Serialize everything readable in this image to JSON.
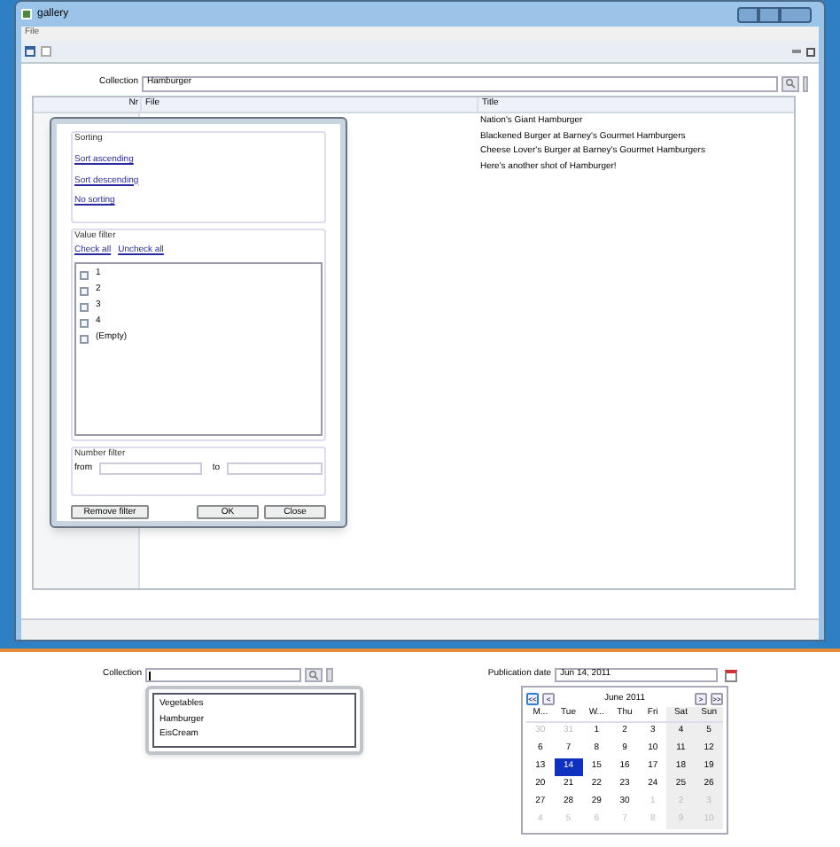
{
  "window": {
    "title": "gallery"
  },
  "menu": [
    "File"
  ],
  "collection": {
    "label": "Collection",
    "value": "Hamburger"
  },
  "table": {
    "columns": [
      "Nr",
      "File",
      "Title"
    ],
    "rows": [
      {
        "title": "Nation's Giant Hamburger"
      },
      {
        "title": "Blackened Burger at Barney's Gourmet Hamburgers"
      },
      {
        "title": "Cheese Lover's Burger at Barney's Gourmet Hamburgers"
      },
      {
        "title": "Here's another shot of Hamburger!"
      }
    ]
  },
  "filter_popup": {
    "sorting": {
      "legend": "Sorting",
      "links": [
        "Sort ascending",
        "Sort descending",
        "No sorting"
      ]
    },
    "value_filter": {
      "legend": "Value filter",
      "check_all": "Check all",
      "uncheck_all": "Uncheck all",
      "items": [
        {
          "label": "1",
          "checked": false
        },
        {
          "label": "2",
          "checked": false
        },
        {
          "label": "3",
          "checked": false
        },
        {
          "label": "4",
          "checked": false
        },
        {
          "label": "(Empty)",
          "checked": false
        }
      ]
    },
    "number_filter": {
      "legend": "Number filter",
      "from": "from",
      "to": "to"
    },
    "buttons": {
      "remove": "Remove filter",
      "ok": "OK",
      "close": "Close"
    }
  },
  "bottom_collection": {
    "label": "Collection",
    "options": [
      "Vegetables",
      "Hamburger",
      "EisCream"
    ]
  },
  "publication_date": {
    "label": "Publication date",
    "value": "Jun 14, 2011",
    "calendar": {
      "month": "June 2011",
      "nav": [
        "<<",
        "<",
        ">",
        ">>"
      ],
      "weekdays": [
        "M...",
        "Tue",
        "W...",
        "Thu",
        "Fri",
        "Sat",
        "Sun"
      ],
      "days": [
        {
          "text": "30",
          "other_month": true,
          "selected": false
        },
        {
          "text": "31",
          "other_month": true,
          "selected": false
        },
        {
          "text": "1",
          "other_month": false,
          "selected": false
        },
        {
          "text": "2",
          "other_month": false,
          "selected": false
        },
        {
          "text": "3",
          "other_month": false,
          "selected": false
        },
        {
          "text": "4",
          "other_month": false,
          "selected": false
        },
        {
          "text": "5",
          "other_month": false,
          "selected": false
        },
        {
          "text": "6",
          "other_month": false,
          "selected": false
        },
        {
          "text": "7",
          "other_month": false,
          "selected": false
        },
        {
          "text": "8",
          "other_month": false,
          "selected": false
        },
        {
          "text": "9",
          "other_month": false,
          "selected": false
        },
        {
          "text": "10",
          "other_month": false,
          "selected": false
        },
        {
          "text": "11",
          "other_month": false,
          "selected": false
        },
        {
          "text": "12",
          "other_month": false,
          "selected": false
        },
        {
          "text": "13",
          "other_month": false,
          "selected": false
        },
        {
          "text": "14",
          "other_month": false,
          "selected": true
        },
        {
          "text": "15",
          "other_month": false,
          "selected": false
        },
        {
          "text": "16",
          "other_month": false,
          "selected": false
        },
        {
          "text": "17",
          "other_month": false,
          "selected": false
        },
        {
          "text": "18",
          "other_month": false,
          "selected": false
        },
        {
          "text": "19",
          "other_month": false,
          "selected": false
        },
        {
          "text": "20",
          "other_month": false,
          "selected": false
        },
        {
          "text": "21",
          "other_month": false,
          "selected": false
        },
        {
          "text": "22",
          "other_month": false,
          "selected": false
        },
        {
          "text": "23",
          "other_month": false,
          "selected": false
        },
        {
          "text": "24",
          "other_month": false,
          "selected": false
        },
        {
          "text": "25",
          "other_month": false,
          "selected": false
        },
        {
          "text": "26",
          "other_month": false,
          "selected": false
        },
        {
          "text": "27",
          "other_month": false,
          "selected": false
        },
        {
          "text": "28",
          "other_month": false,
          "selected": false
        },
        {
          "text": "29",
          "other_month": false,
          "selected": false
        },
        {
          "text": "30",
          "other_month": false,
          "selected": false
        },
        {
          "text": "1",
          "other_month": true,
          "selected": false
        },
        {
          "text": "2",
          "other_month": true,
          "selected": false
        },
        {
          "text": "3",
          "other_month": true,
          "selected": false
        },
        {
          "text": "4",
          "other_month": true,
          "selected": false
        },
        {
          "text": "5",
          "other_month": true,
          "selected": false
        },
        {
          "text": "6",
          "other_month": true,
          "selected": false
        },
        {
          "text": "7",
          "other_month": true,
          "selected": false
        },
        {
          "text": "8",
          "other_month": true,
          "selected": false
        },
        {
          "text": "9",
          "other_month": true,
          "selected": false
        },
        {
          "text": "10",
          "other_month": true,
          "selected": false
        }
      ]
    }
  }
}
